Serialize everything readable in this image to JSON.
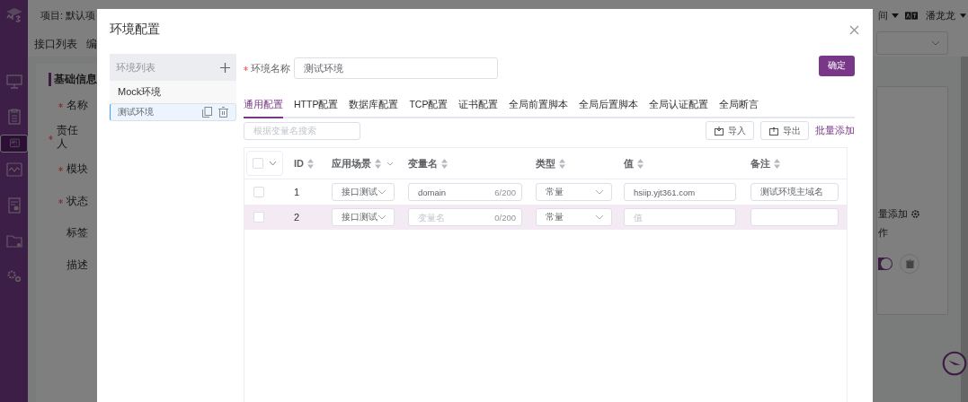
{
  "sidebar": {
    "items": [
      {
        "kind": "logo",
        "selected": false
      },
      {
        "kind": "monitor",
        "selected": false
      },
      {
        "kind": "clipboard",
        "selected": false
      },
      {
        "kind": "api",
        "selected": true
      },
      {
        "kind": "chart",
        "selected": false
      },
      {
        "kind": "report",
        "selected": false
      },
      {
        "kind": "folder",
        "selected": false
      },
      {
        "kind": "gears",
        "selected": false
      }
    ]
  },
  "header": {
    "project": "项目: 默认项",
    "workspace": "间",
    "user": "潘龙龙"
  },
  "page_tabs": [
    "接口列表",
    "编"
  ],
  "form": {
    "section": "基础信息",
    "fields": [
      {
        "label": "名称",
        "required": true
      },
      {
        "label": "责任人",
        "required": true
      },
      {
        "label": "模块",
        "required": true
      },
      {
        "label": "状态",
        "required": true
      },
      {
        "label": "标签",
        "required": false
      },
      {
        "label": "描述",
        "required": false
      }
    ]
  },
  "side_card": {
    "batch_add": "量添加",
    "column": "作",
    "toggle_on": true
  },
  "modal": {
    "title": "环境配置",
    "env_list": {
      "title": "环境列表",
      "items": [
        {
          "name": "Mock环境",
          "selected": false
        },
        {
          "name": "测试环境",
          "selected": true
        }
      ]
    },
    "name_field": {
      "label": "环境名称",
      "required": true,
      "value": "测试环境"
    },
    "confirm": "确定",
    "tabs": [
      {
        "label": "通用配置",
        "selected": true
      },
      {
        "label": "HTTP配置",
        "selected": false
      },
      {
        "label": "数据库配置",
        "selected": false
      },
      {
        "label": "TCP配置",
        "selected": false
      },
      {
        "label": "证书配置",
        "selected": false
      },
      {
        "label": "全局前置脚本",
        "selected": false
      },
      {
        "label": "全局后置脚本",
        "selected": false
      },
      {
        "label": "全局认证配置",
        "selected": false
      },
      {
        "label": "全局断言",
        "selected": false
      }
    ],
    "search": {
      "placeholder": "根据变量名搜索"
    },
    "import": "导入",
    "export": "导出",
    "batch_add": "批量添加",
    "table": {
      "select_all": {
        "checked": false
      },
      "columns": [
        {
          "label": "ID",
          "filter": false
        },
        {
          "label": "应用场景",
          "filter": true
        },
        {
          "label": "变量名",
          "filter": false
        },
        {
          "label": "类型",
          "filter": false
        },
        {
          "label": "值",
          "filter": false
        },
        {
          "label": "备注",
          "filter": false
        }
      ],
      "rows": [
        {
          "checked": false,
          "highlighted": false,
          "id": "1",
          "scene": "接口测试",
          "name": {
            "value": "domain"
          },
          "count": "6/200",
          "type": "常量",
          "value": {
            "value": "hsiip.yjt361.com"
          },
          "note": {
            "value": "测试环境主域名"
          }
        },
        {
          "checked": false,
          "highlighted": true,
          "id": "2",
          "scene": "接口测试",
          "name": {
            "placeholder": "变量名"
          },
          "count": "0/200",
          "type": "常量",
          "value": {
            "placeholder": "值"
          },
          "note": {}
        }
      ]
    }
  }
}
